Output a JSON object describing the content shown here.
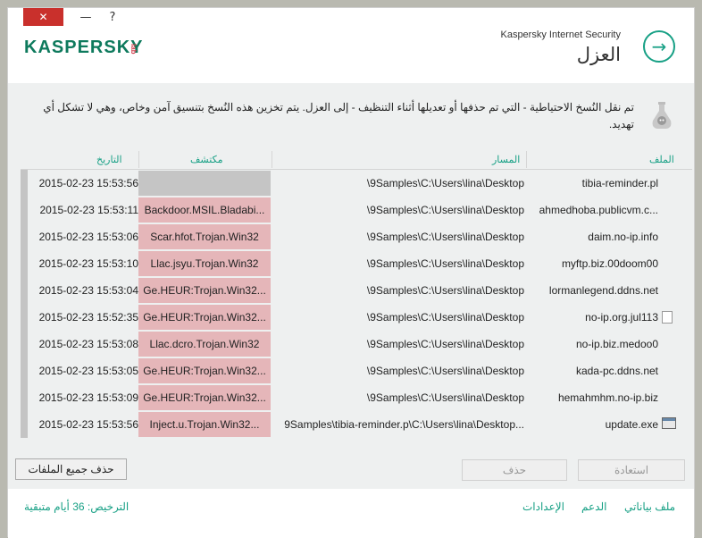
{
  "titlebar": {
    "close": "✕",
    "minimize": "—",
    "help": "?"
  },
  "brand": {
    "logo_text": "KASPERSKY",
    "logo_lab": "lab"
  },
  "header": {
    "app_name": "Kaspersky Internet Security",
    "section_title": "العزل",
    "nav_arrow": "→"
  },
  "info": {
    "text": "تم نقل النُسخ الاحتياطية - التي تم حذفها أو تعديلها أثناء التنظيف - إلى العزل. يتم تخزين هذه النُسخ بتنسيق آمن وخاص، وهي لا تشكل أي تهديد."
  },
  "table": {
    "headers": {
      "file": "الملف",
      "path": "المسار",
      "detector": "مكتشف",
      "date": "التاريخ"
    },
    "rows": [
      {
        "file": "tibia-reminder.pl",
        "path": "\\9Samples\\C:\\Users\\lina\\Desktop",
        "detector": "",
        "date": "2015-02-23 15:53:56",
        "icon": "none"
      },
      {
        "file": "ahmedhoba.publicvm.c...",
        "path": "\\9Samples\\C:\\Users\\lina\\Desktop",
        "detector": "Backdoor.MSIL.Bladabi...",
        "date": "2015-02-23 15:53:11",
        "icon": "none"
      },
      {
        "file": "daim.no-ip.info",
        "path": "\\9Samples\\C:\\Users\\lina\\Desktop",
        "detector": "Scar.hfot.Trojan.Win32",
        "date": "2015-02-23 15:53:06",
        "icon": "none"
      },
      {
        "file": "myftp.biz.00doom00",
        "path": "\\9Samples\\C:\\Users\\lina\\Desktop",
        "detector": "Llac.jsyu.Trojan.Win32",
        "date": "2015-02-23 15:53:10",
        "icon": "none"
      },
      {
        "file": "lormanlegend.ddns.net",
        "path": "\\9Samples\\C:\\Users\\lina\\Desktop",
        "detector": "Ge.HEUR:Trojan.Win32...",
        "date": "2015-02-23 15:53:04",
        "icon": "none"
      },
      {
        "file": "no-ip.org.jul113",
        "path": "\\9Samples\\C:\\Users\\lina\\Desktop",
        "detector": "Ge.HEUR:Trojan.Win32...",
        "date": "2015-02-23 15:52:35",
        "icon": "file-icon"
      },
      {
        "file": "no-ip.biz.medoo0",
        "path": "\\9Samples\\C:\\Users\\lina\\Desktop",
        "detector": "Llac.dcro.Trojan.Win32",
        "date": "2015-02-23 15:53:08",
        "icon": "none"
      },
      {
        "file": "kada-pc.ddns.net",
        "path": "\\9Samples\\C:\\Users\\lina\\Desktop",
        "detector": "Ge.HEUR:Trojan.Win32...",
        "date": "2015-02-23 15:53:05",
        "icon": "none"
      },
      {
        "file": "hemahmhm.no-ip.biz",
        "path": "\\9Samples\\C:\\Users\\lina\\Desktop",
        "detector": "Ge.HEUR:Trojan.Win32...",
        "date": "2015-02-23 15:53:09",
        "icon": "none"
      },
      {
        "file": "update.exe",
        "path": "9Samples\\tibia-reminder.p\\C:\\Users\\lina\\Desktop...",
        "detector": "Inject.u.Trojan.Win32...",
        "date": "2015-02-23 15:53:56",
        "icon": "exe-icon"
      }
    ]
  },
  "buttons": {
    "delete_all": "حذف جميع الملفات",
    "delete": "حذف",
    "restore": "استعادة"
  },
  "footer": {
    "license": "الترخيص: 36  أيام متبقية",
    "settings": "الإعدادات",
    "support": "الدعم",
    "profile": "ملف بياناتي"
  },
  "colors": {
    "accent": "#17a085",
    "detector_bg": "#e5b6b9",
    "close_btn": "#c9302c"
  }
}
